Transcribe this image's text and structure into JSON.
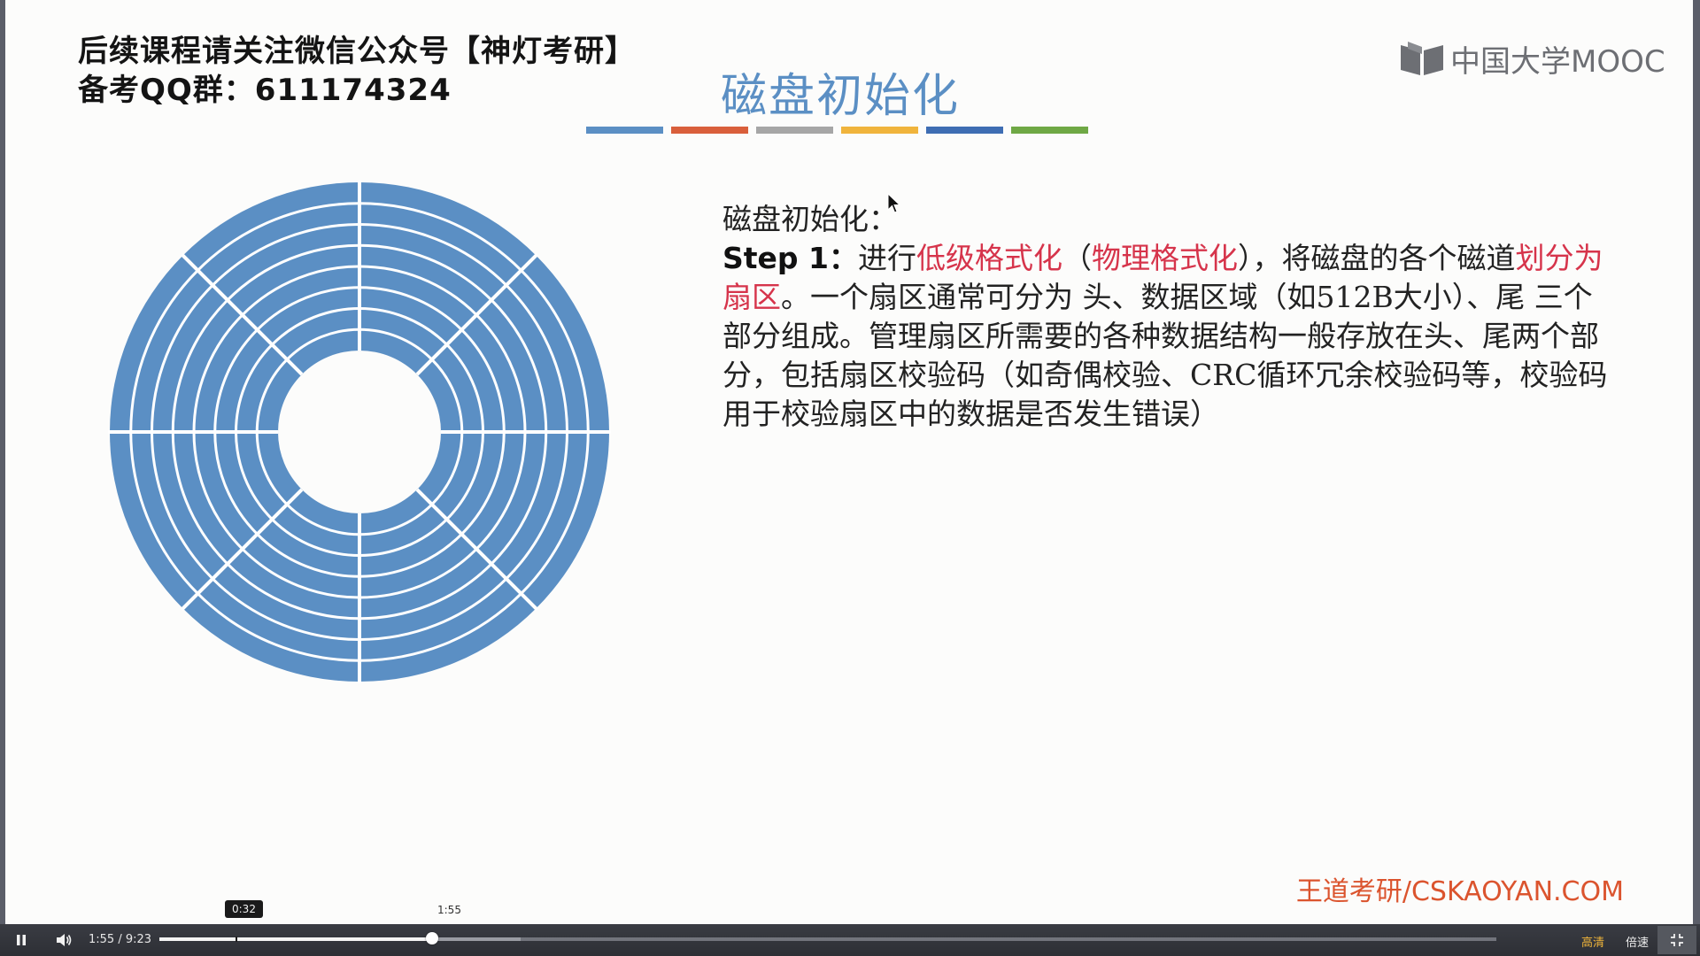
{
  "slide": {
    "notice_line1": "后续课程请关注微信公众号【神灯考研】",
    "notice_line2": "备考QQ群：611174324",
    "title": "磁盘初始化",
    "title_color": "#5b8fc4",
    "divider_colors": [
      "#5b8fc4",
      "#d95f3b",
      "#a6a6a6",
      "#f0b43c",
      "#3e6db3",
      "#6fa845"
    ],
    "logo_text": "中国大学MOOC",
    "disk_color": "#5b8fc4",
    "content": {
      "heading": "磁盘初始化：",
      "step_label": "Step 1：",
      "seg1": "进行",
      "red1": "低级格式化",
      "seg2": "（",
      "red2": "物理格式化",
      "seg3": "），将磁盘的各个磁道",
      "red3": "划分为扇区",
      "seg4": "。一个扇区通常可分为 头、数据区域（如512B大小）、尾 三个部分组成。管理扇区所需要的各种数据结构一般存放在头、尾两个部分，包括扇区校验码（如奇偶校验、CRC循环冗余校验码等，校验码用于校验扇区中的数据是否发生错误）"
    },
    "watermark": "王道考研/CSKAOYAN.COM"
  },
  "player": {
    "current_time": "1:55",
    "separator": " / ",
    "duration": "9:23",
    "hover_time": "0:32",
    "current_marker": "1:55",
    "progress_fraction": 0.2043,
    "buffered_fraction": 0.27,
    "hover_fraction": 0.0568,
    "quality_label": "高清",
    "speed_label": "倍速",
    "play_state": "pause-icon",
    "volume_icon": "volume-icon",
    "fullscreen_icon": "exit-fullscreen-icon"
  }
}
